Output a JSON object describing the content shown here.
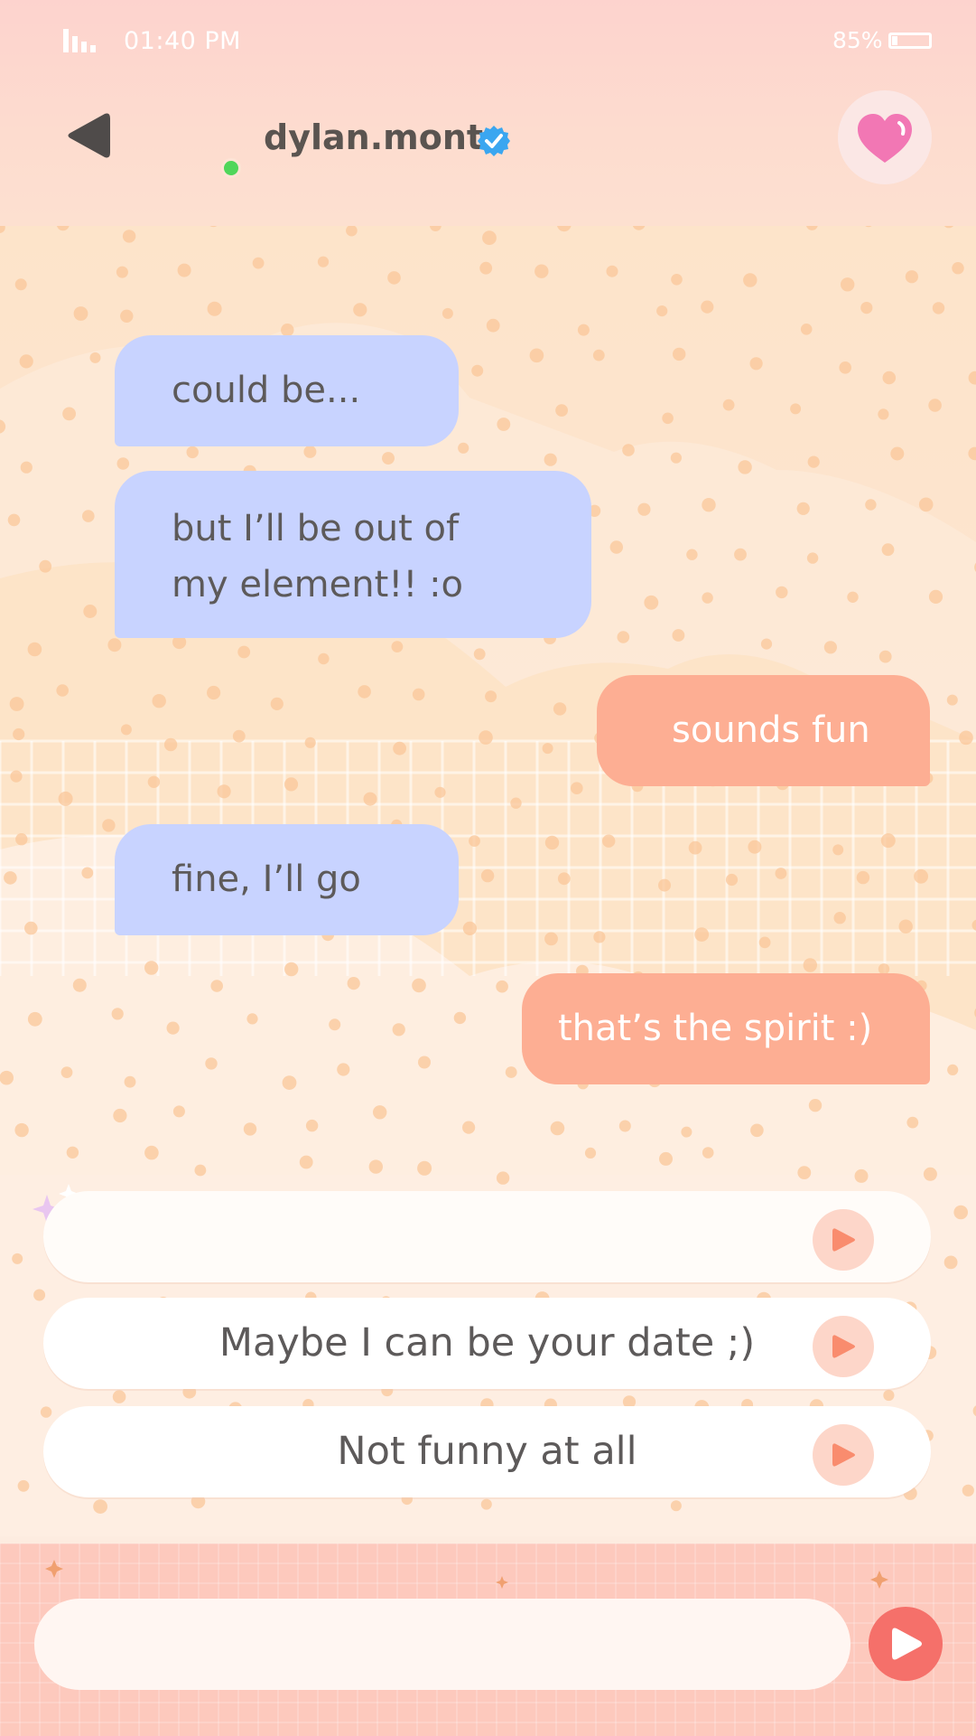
{
  "status_bar": {
    "time": "01:40 PM",
    "battery": "85%"
  },
  "header": {
    "contact_name": "dylan.mont",
    "back_icon": "back-triangle-icon",
    "verified_icon": "verified-badge-icon",
    "heart_icon": "heart-icon",
    "online": true
  },
  "messages": [
    {
      "side": "in",
      "text": "could be..."
    },
    {
      "side": "in",
      "line1": "but I’ll be out of",
      "line2": "my element!! :o"
    },
    {
      "side": "out",
      "text": "sounds fun"
    },
    {
      "side": "in",
      "text": "fine, I’ll go"
    },
    {
      "side": "out",
      "text": "that’s the spirit :)"
    }
  ],
  "choices": [
    {
      "label": ""
    },
    {
      "label": "Maybe I can be your date ;)"
    },
    {
      "label": "Not funny at all"
    }
  ],
  "composer": {
    "value": "",
    "placeholder": ""
  },
  "colors": {
    "incoming_bubble": "#c8d3ff",
    "outgoing_bubble": "#fdae93",
    "send_button": "#f5706a",
    "heart": "#f277b4",
    "online": "#4fd65a",
    "verified": "#3aa6f0"
  }
}
